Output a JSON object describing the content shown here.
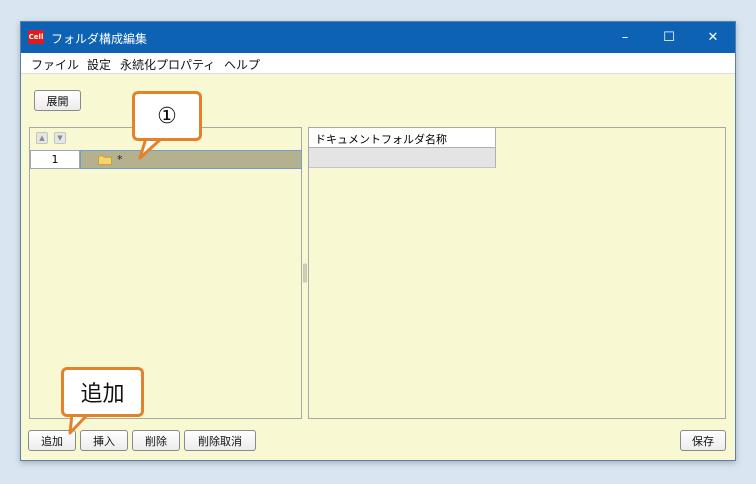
{
  "window": {
    "title": "フォルダ構成編集",
    "app_icon_text": "Cell",
    "controls": {
      "minimize": "–",
      "maximize": "☐",
      "close": "✕"
    }
  },
  "menu": [
    "ファイル",
    "設定",
    "永続化プロパティ",
    "ヘルプ"
  ],
  "toolbar": {
    "expand_label": "展開"
  },
  "left_panel": {
    "up_icon": "▲",
    "down_icon": "▼",
    "rows": [
      {
        "number": "1",
        "text": "*"
      }
    ]
  },
  "right_panel": {
    "column_header": "ドキュメントフォルダ名称"
  },
  "bottom_buttons": {
    "add": "追加",
    "insert": "挿入",
    "delete": "削除",
    "undo_delete": "削除取消",
    "save": "保存"
  },
  "callouts": {
    "marker": "①",
    "add_label": "追加"
  },
  "colors": {
    "titlebar": "#0e62b4",
    "window_bg": "#f8f8d2",
    "selected_row": "#b5b18f",
    "callout_border": "#e2832c"
  }
}
